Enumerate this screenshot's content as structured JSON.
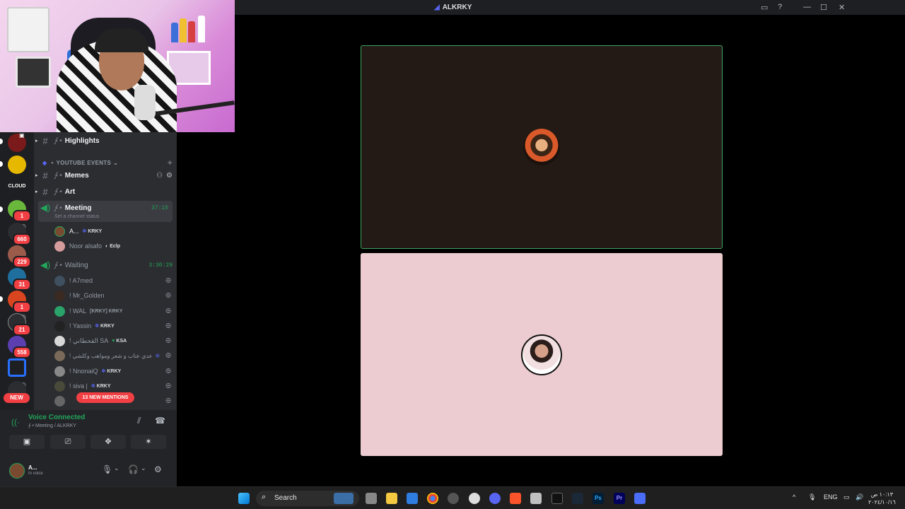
{
  "window": {
    "title": "ALKRKY"
  },
  "rail": {
    "badges": [
      "1",
      "660",
      "229",
      "31",
      "1",
      "21",
      "558"
    ],
    "new_label": "NEW"
  },
  "channels": {
    "highlights": "Highlights",
    "category": "YOUTUBE EVENTS",
    "memes": "Memes",
    "art": "Art",
    "meeting": {
      "name": "Meeting",
      "timer": "37:15",
      "status_placeholder": "Set a channel status"
    },
    "meeting_users": [
      {
        "name": "A...",
        "tag": "KRKY"
      },
      {
        "name": "Noor alsafo",
        "tag": "Eclp"
      }
    ],
    "waiting": {
      "name": "Waiting",
      "timer": "3:30:29"
    },
    "waiting_users": [
      {
        "name": "! A7med",
        "tag": ""
      },
      {
        "name": "! Mr_Golden",
        "tag": ""
      },
      {
        "name": "! WAL",
        "tag": "[KRKY]  KRKY"
      },
      {
        "name": "! Yassin",
        "tag": "KRKY"
      },
      {
        "name": "! القحطاني SA",
        "tag": "KSA"
      },
      {
        "name": "! عدي عتاب و شعر ومواهب وكلشي",
        "tag": ""
      },
      {
        "name": "! NnonaiQ",
        "tag": "KRKY"
      },
      {
        "name": "! siva |",
        "tag": "KRKY"
      }
    ],
    "mentions": "13 NEW MENTIONS"
  },
  "voice": {
    "status": "Voice Connected",
    "location": "Meeting / ALKRKY"
  },
  "me": {
    "name": "A...",
    "status": "In voice"
  },
  "taskbar": {
    "search": "Search",
    "lang": "ENG",
    "time": "١٠:١٣ ص",
    "date": "٢٠٢٤/١٠/١٦"
  }
}
